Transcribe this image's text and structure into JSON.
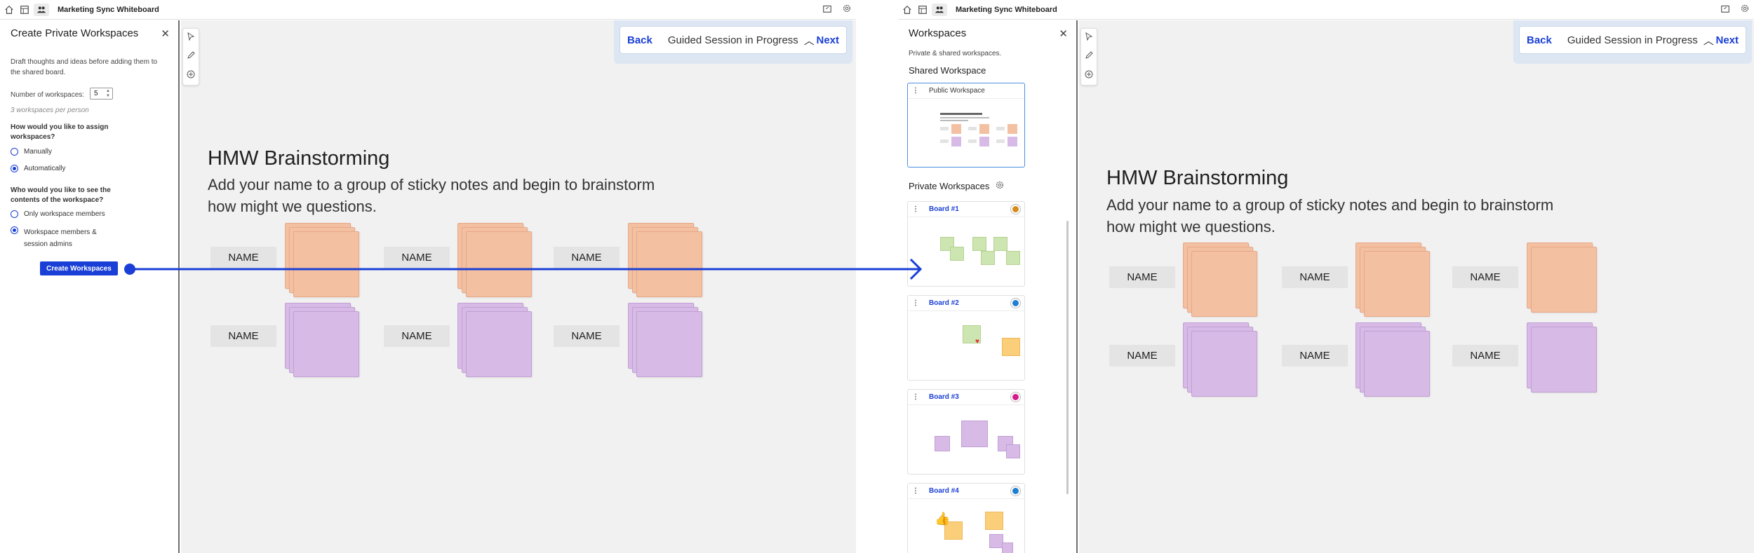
{
  "app": {
    "title": "Marketing Sync Whiteboard"
  },
  "guided": {
    "back": "Back",
    "status": "Guided Session in Progress",
    "next": "Next"
  },
  "board": {
    "title": "HMW Brainstorming",
    "subtitle": "Add your name to a group of sticky notes and begin to brainstorm how might we questions.",
    "name_label": "NAME",
    "orange": "#f3c0a1",
    "purple": "#d7bbe6"
  },
  "create_panel": {
    "title": "Create Private Workspaces",
    "description": "Draft thoughts and ideas before adding them to the shared board.",
    "num_label": "Number of workspaces:",
    "num_value": "5",
    "per_person": "3 workspaces per person",
    "assign_question": "How would you like to assign workspaces?",
    "assign_options": [
      "Manually",
      "Automatically"
    ],
    "assign_selected": "Automatically",
    "view_question": "Who would you like to see the contents of the workspace?",
    "view_options": [
      "Only workspace members",
      "Workspace members & session admins"
    ],
    "view_selected": "Workspace members & session admins",
    "button": "Create Workspaces"
  },
  "workspaces_panel": {
    "title": "Workspaces",
    "subtitle": "Private & shared workspaces.",
    "shared_heading": "Shared Workspace",
    "public_label": "Public Workspace",
    "private_heading": "Private Workspaces",
    "boards": [
      {
        "label": "Board #1",
        "avatar_color": "#d88a1c"
      },
      {
        "label": "Board #2",
        "avatar_color": "#1f7fd1"
      },
      {
        "label": "Board #3",
        "avatar_color": "#d61c8a"
      },
      {
        "label": "Board #4",
        "avatar_color": "#1f7fd1"
      }
    ]
  },
  "colors": {
    "accent": "#1a3fd6",
    "canvas": "#f1f1f1"
  }
}
